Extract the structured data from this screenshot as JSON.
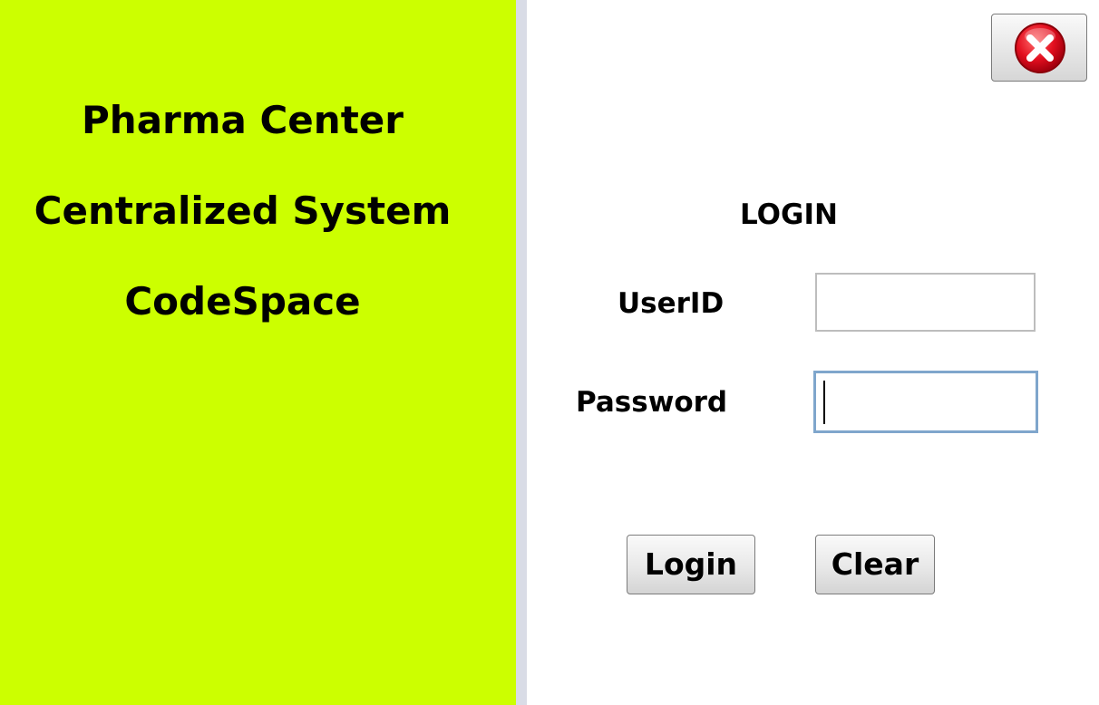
{
  "brand": {
    "line1": "Pharma Center",
    "line2": "Centralized System",
    "line3": "CodeSpace",
    "background_color": "#ccff00"
  },
  "login": {
    "title": "LOGIN",
    "userid_label": "UserID",
    "userid_value": "",
    "password_label": "Password",
    "password_value": "",
    "login_button": "Login",
    "clear_button": "Clear",
    "close_icon": "close-icon",
    "focus_color": "#7fa6cc"
  }
}
